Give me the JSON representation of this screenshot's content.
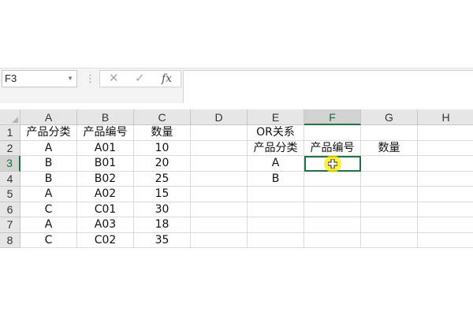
{
  "name_box": {
    "value": "F3"
  },
  "formula_bar": {
    "cancel_icon": "x-icon",
    "enter_icon": "check-icon",
    "fx_label": "fx",
    "value": ""
  },
  "columns": [
    "A",
    "B",
    "C",
    "D",
    "E",
    "F",
    "G",
    "H"
  ],
  "rows": [
    "1",
    "2",
    "3",
    "4",
    "5",
    "6",
    "7",
    "8"
  ],
  "selected": {
    "column": "F",
    "row": "3"
  },
  "cells": {
    "A1": "产品分类",
    "B1": "产品编号",
    "C1": "数量",
    "E1": "OR关系",
    "A2": "A",
    "B2": "A01",
    "C2": "10",
    "E2": "产品分类",
    "F2": "产品编号",
    "G2": "数量",
    "A3": "B",
    "B3": "B01",
    "C3": "20",
    "E3": "A",
    "A4": "B",
    "B4": "B02",
    "C4": "25",
    "E4": "B",
    "A5": "A",
    "B5": "A02",
    "C5": "15",
    "A6": "C",
    "B6": "C01",
    "C6": "30",
    "A7": "A",
    "B7": "A03",
    "C7": "18",
    "A8": "C",
    "B8": "C02",
    "C8": "35"
  },
  "colors": {
    "accent": "#217346",
    "highlight": "#ffeb00"
  }
}
